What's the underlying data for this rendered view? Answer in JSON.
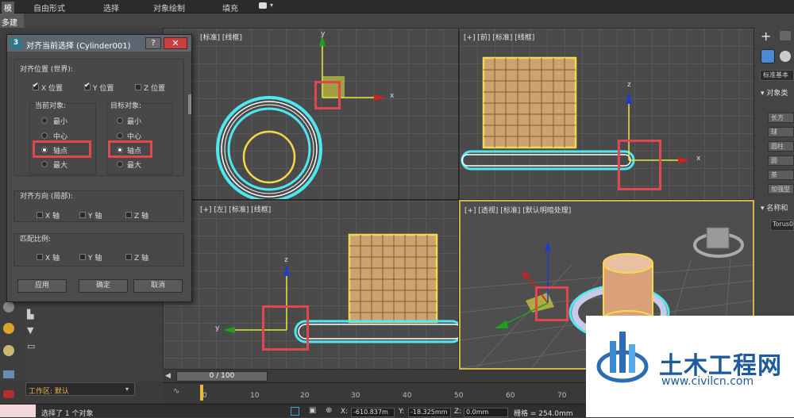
{
  "menubar": {
    "items": [
      "自由形式",
      "选择",
      "对象绘制",
      "填充"
    ],
    "left_fragment": "模"
  },
  "ribbon": {
    "tab": "多建模"
  },
  "viewports": {
    "top": "[标准] [线框]",
    "front": "[+] [前] [标准] [线框]",
    "left": "[+] [左] [标准] [线框]",
    "perspective": "[+] [透视] [标准] [默认明暗处理]"
  },
  "axes": {
    "x": "x",
    "y": "y",
    "z": "z"
  },
  "dialog": {
    "icon": "3",
    "title": "对齐当前选择 (Cylinder001)",
    "help_label": "?",
    "close_label": "✕",
    "align_position_label": "对齐位置 (世界):",
    "x_pos": "X 位置",
    "y_pos": "Y 位置",
    "z_pos": "Z 位置",
    "x_checked": true,
    "y_checked": true,
    "z_checked": false,
    "current_object_label": "当前对象:",
    "target_object_label": "目标对象:",
    "current_options": [
      "最小",
      "中心",
      "轴点",
      "最大"
    ],
    "target_options": [
      "最小",
      "中心",
      "轴点",
      "最大"
    ],
    "current_selected": "轴点",
    "target_selected": "轴点",
    "align_orientation_label": "对齐方向 (局部):",
    "orientation_axes": [
      "X 轴",
      "Y 轴",
      "Z 轴"
    ],
    "match_scale_label": "匹配比例:",
    "scale_axes": [
      "X 轴",
      "Y 轴",
      "Z 轴"
    ],
    "apply": "应用",
    "ok": "确定",
    "cancel": "取消"
  },
  "command_panel": {
    "plus_icon": "+",
    "dropdown": "标准基本",
    "object_type_header": "对象类",
    "buttons": [
      "长方",
      "球",
      "圆柱",
      "圆",
      "茶",
      "加强型"
    ],
    "name_header": "名称和",
    "name_value": "Torus0"
  },
  "timeline": {
    "frame_display": "0 / 100",
    "ticks": [
      "0",
      "10",
      "20",
      "30",
      "40",
      "50",
      "60",
      "70"
    ]
  },
  "left_panel": {
    "workspace": "工作区: 默认"
  },
  "status": {
    "message": "选择了 1 个对象",
    "x_label": "X:",
    "x_value": "-610.837m",
    "y_label": "Y:",
    "y_value": "-18.325mm",
    "z_label": "Z:",
    "z_value": "0.0mm",
    "grid_label": "栅格 = 254.0mm"
  },
  "watermark": {
    "title": "土木工程网",
    "url": "www.civilcn.com"
  },
  "colors": {
    "selection_red": "#e0484f",
    "axis_yellow": "#e8e83a",
    "wire_cyan": "#4ee8f0",
    "object_yellow": "#f5d94a"
  }
}
